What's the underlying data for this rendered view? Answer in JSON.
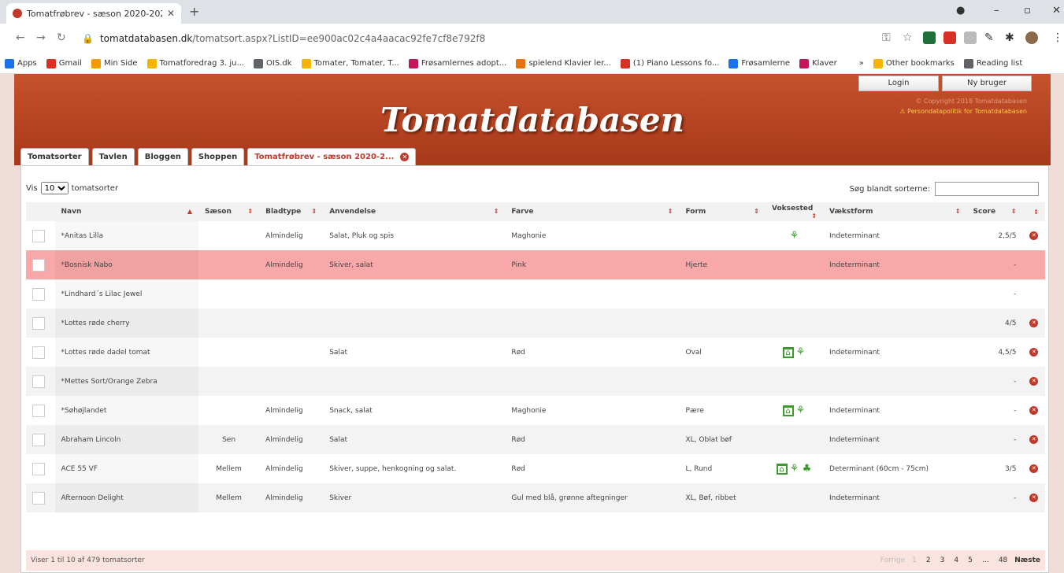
{
  "browser": {
    "tab_title": "Tomatfrøbrev - sæson 2020-202",
    "url_host": "tomatdatabasen.dk",
    "url_path": "/tomatsort.aspx?ListID=ee900ac02c4a4aacac92fe7cf8e792f8",
    "bookmarks": [
      {
        "label": "Apps",
        "color": "#1a73e8"
      },
      {
        "label": "Gmail",
        "color": "#d93025"
      },
      {
        "label": "Min Side",
        "color": "#f29900"
      },
      {
        "label": "Tomatforedrag 3. ju...",
        "color": "#f4b400"
      },
      {
        "label": "OIS.dk",
        "color": "#5f6368"
      },
      {
        "label": "Tomater, Tomater, T...",
        "color": "#f4b400"
      },
      {
        "label": "Frøsamlernes adopt...",
        "color": "#c2185b"
      },
      {
        "label": "spielend Klavier ler...",
        "color": "#e8710a"
      },
      {
        "label": "(1) Piano Lessons fo...",
        "color": "#d93025"
      },
      {
        "label": "Frøsamlerne",
        "color": "#1a73e8"
      },
      {
        "label": "Klaver",
        "color": "#c2185b"
      },
      {
        "label": "»",
        "color": "#ffffff"
      },
      {
        "label": "Other bookmarks",
        "color": "#f4b400"
      },
      {
        "label": "Reading list",
        "color": "#5f6368"
      }
    ]
  },
  "site": {
    "logo": "Tomatdatabasen",
    "login": "Login",
    "new_user": "Ny bruger",
    "copyright": "© Copyright 2018 Tomatdatabasen",
    "policy": "⚠ Persondatapolitik for Tomatdatabasen",
    "tabs": [
      "Tomatsorter",
      "Tavlen",
      "Bloggen",
      "Shoppen"
    ],
    "active_tab": "Tomatfrøbrev - sæson 2020-2..."
  },
  "list": {
    "show_label": "Vis",
    "show_value": "10",
    "show_suffix": "tomatsorter",
    "search_label": "Søg blandt sorterne:",
    "search_value": "",
    "columns": [
      "Navn",
      "Sæson",
      "Bladtype",
      "Anvendelse",
      "Farve",
      "Form",
      "Voksested",
      "Vækstform",
      "Score"
    ],
    "rows": [
      {
        "navn": "*Anitas Lilla",
        "saeson": "",
        "bladtype": "Almindelig",
        "anvendelse": "Salat, Pluk og spis",
        "farve": "Maghonie",
        "form": "",
        "voks": [
          "plant"
        ],
        "vaekst": "Indeterminant",
        "score": "2,5/5",
        "del": true
      },
      {
        "navn": "*Bosnisk Nabo",
        "saeson": "",
        "bladtype": "Almindelig",
        "anvendelse": "Skiver, salat",
        "farve": "Pink",
        "form": "Hjerte",
        "voks": [],
        "vaekst": "Indeterminant",
        "score": "-",
        "del": false
      },
      {
        "navn": "*Lindhard´s Lilac Jewel",
        "saeson": "",
        "bladtype": "",
        "anvendelse": "",
        "farve": "",
        "form": "",
        "voks": [],
        "vaekst": "",
        "score": "-",
        "del": false
      },
      {
        "navn": "*Lottes røde cherry",
        "saeson": "",
        "bladtype": "",
        "anvendelse": "",
        "farve": "",
        "form": "",
        "voks": [],
        "vaekst": "",
        "score": "4/5",
        "del": true
      },
      {
        "navn": "*Lottes røde dadel tomat",
        "saeson": "",
        "bladtype": "",
        "anvendelse": "Salat",
        "farve": "Rød",
        "form": "Oval",
        "voks": [
          "house",
          "plant"
        ],
        "vaekst": "Indeterminant",
        "score": "4,5/5",
        "del": true
      },
      {
        "navn": "*Mettes Sort/Orange Zebra",
        "saeson": "",
        "bladtype": "",
        "anvendelse": "",
        "farve": "",
        "form": "",
        "voks": [],
        "vaekst": "",
        "score": "-",
        "del": true
      },
      {
        "navn": "*Søhøjlandet",
        "saeson": "",
        "bladtype": "Almindelig",
        "anvendelse": "Snack, salat",
        "farve": "Maghonie",
        "form": "Pære",
        "voks": [
          "house",
          "plant"
        ],
        "vaekst": "Indeterminant",
        "score": "-",
        "del": true
      },
      {
        "navn": "Abraham Lincoln",
        "saeson": "Sen",
        "bladtype": "Almindelig",
        "anvendelse": "Salat",
        "farve": "Rød",
        "form": "XL, Oblat bøf",
        "voks": [],
        "vaekst": "Indeterminant",
        "score": "-",
        "del": true
      },
      {
        "navn": "ACE 55 VF",
        "saeson": "Mellem",
        "bladtype": "Almindelig",
        "anvendelse": "Skiver, suppe, henkogning og salat.",
        "farve": "Rød",
        "form": "L, Rund",
        "voks": [
          "house",
          "plant",
          "pot"
        ],
        "vaekst": "Determinant (60cm - 75cm)",
        "score": "3/5",
        "del": true
      },
      {
        "navn": "Afternoon Delight",
        "saeson": "Mellem",
        "bladtype": "Almindelig",
        "anvendelse": "Skiver",
        "farve": "Gul med blå, grønne aftegninger",
        "form": "XL, Bøf, ribbet",
        "voks": [],
        "vaekst": "Indeterminant",
        "score": "-",
        "del": true
      }
    ],
    "info": "Viser 1 til 10 af 479 tomatsorter",
    "pager": {
      "prev": "Forrige",
      "pages": [
        "1",
        "2",
        "3",
        "4",
        "5",
        "…",
        "48"
      ],
      "next": "Næste"
    }
  }
}
